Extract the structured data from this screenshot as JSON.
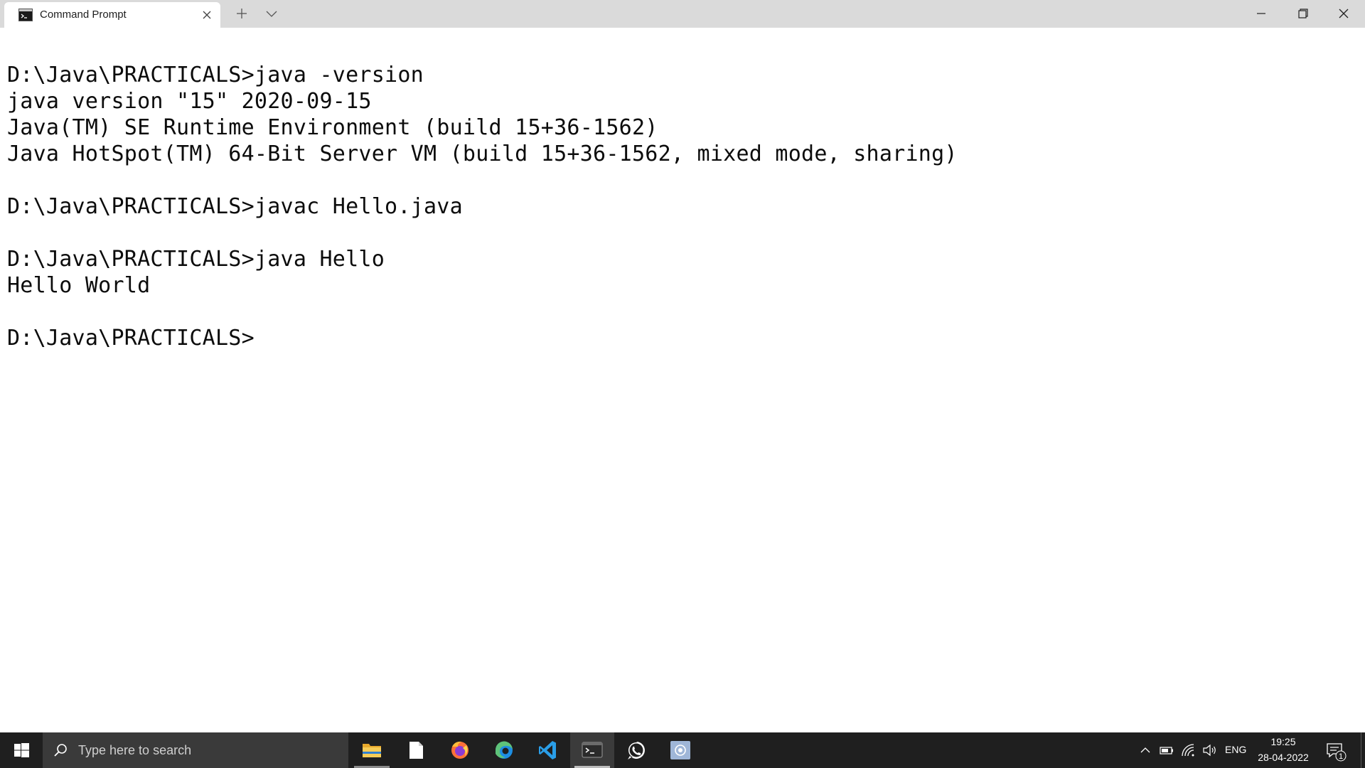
{
  "tab": {
    "title": "Command Prompt",
    "icon": "cmd-icon"
  },
  "terminal": {
    "lines": [
      "D:\\Java\\PRACTICALS>java -version",
      "java version \"15\" 2020-09-15",
      "Java(TM) SE Runtime Environment (build 15+36-1562)",
      "Java HotSpot(TM) 64-Bit Server VM (build 15+36-1562, mixed mode, sharing)",
      "",
      "D:\\Java\\PRACTICALS>javac Hello.java",
      "",
      "D:\\Java\\PRACTICALS>java Hello",
      "Hello World",
      "",
      "D:\\Java\\PRACTICALS>"
    ]
  },
  "taskbar": {
    "search_placeholder": "Type here to search",
    "apps": [
      "file-explorer",
      "notepad",
      "firefox",
      "edge",
      "vscode",
      "windows-terminal",
      "whatsapp",
      "app"
    ],
    "active_app": "windows-terminal",
    "language": "ENG",
    "time": "19:25",
    "date": "28-04-2022",
    "notification_count": "1"
  },
  "colors": {
    "titlebar": "#dadada",
    "taskbar": "#1f1f1f",
    "terminal_bg": "#ffffff",
    "terminal_fg": "#0c0c0c"
  }
}
